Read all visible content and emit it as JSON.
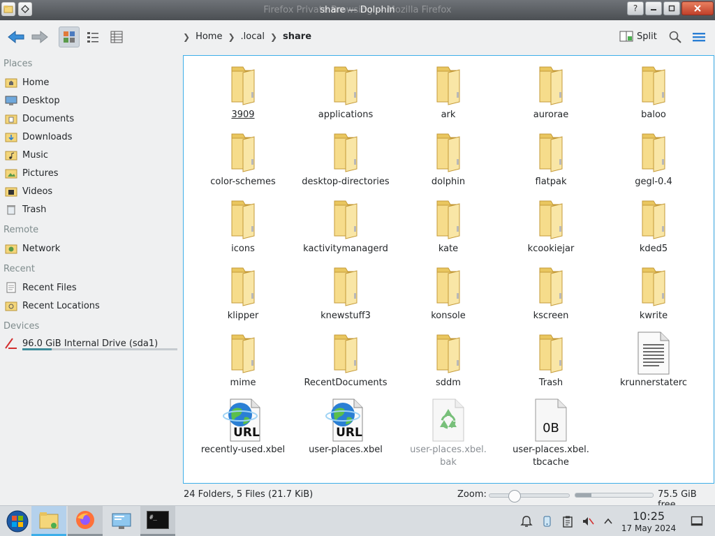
{
  "window": {
    "title": "share — Dolphin",
    "ghost_title": "Firefox Private Browsing — Mozilla Firefox",
    "help_btn": "?"
  },
  "toolbar": {
    "back_icon": "arrow-left-icon",
    "forward_icon": "arrow-right-icon",
    "view_modes": [
      "icons-view",
      "compact-view",
      "details-view"
    ],
    "breadcrumbs": [
      "Home",
      ".local",
      "share"
    ],
    "split_label": "Split",
    "search_icon": "search-icon",
    "menu_icon": "hamburger-menu-icon"
  },
  "sidebar": {
    "places_title": "Places",
    "places": [
      "Home",
      "Desktop",
      "Documents",
      "Downloads",
      "Music",
      "Pictures",
      "Videos",
      "Trash"
    ],
    "remote_title": "Remote",
    "remote": [
      "Network"
    ],
    "recent_title": "Recent",
    "recent": [
      "Recent Files",
      "Recent Locations"
    ],
    "devices_title": "Devices",
    "devices": [
      "96.0 GiB Internal Drive (sda1)"
    ],
    "drive_usage_fraction": 0.19
  },
  "files": {
    "items": [
      {
        "name": "3909",
        "type": "folder"
      },
      {
        "name": "applications",
        "type": "folder"
      },
      {
        "name": "ark",
        "type": "folder"
      },
      {
        "name": "aurorae",
        "type": "folder"
      },
      {
        "name": "baloo",
        "type": "folder"
      },
      {
        "name": "color-schemes",
        "type": "folder"
      },
      {
        "name": "desktop-directories",
        "type": "folder"
      },
      {
        "name": "dolphin",
        "type": "folder"
      },
      {
        "name": "flatpak",
        "type": "folder"
      },
      {
        "name": "gegl-0.4",
        "type": "folder"
      },
      {
        "name": "icons",
        "type": "folder"
      },
      {
        "name": "kactivitymanagerd",
        "type": "folder"
      },
      {
        "name": "kate",
        "type": "folder"
      },
      {
        "name": "kcookiejar",
        "type": "folder"
      },
      {
        "name": "kded5",
        "type": "folder"
      },
      {
        "name": "klipper",
        "type": "folder"
      },
      {
        "name": "knewstuff3",
        "type": "folder"
      },
      {
        "name": "konsole",
        "type": "folder"
      },
      {
        "name": "kscreen",
        "type": "folder"
      },
      {
        "name": "kwrite",
        "type": "folder"
      },
      {
        "name": "mime",
        "type": "folder"
      },
      {
        "name": "RecentDocuments",
        "type": "folder"
      },
      {
        "name": "sddm",
        "type": "folder"
      },
      {
        "name": "Trash",
        "type": "folder"
      },
      {
        "name": "krunnerstaterc",
        "type": "text"
      },
      {
        "name": "recently-used.xbel",
        "type": "url",
        "badge": "URL"
      },
      {
        "name": "user-places.xbel",
        "type": "url",
        "badge": "URL"
      },
      {
        "name": "user-places.xbel.\nbak",
        "type": "recycle",
        "dim": true
      },
      {
        "name": "user-places.xbel.\ntbcache",
        "type": "empty",
        "badge": "0B"
      }
    ]
  },
  "status": {
    "summary": "24 Folders, 5 Files (21.7 KiB)",
    "zoom_label": "Zoom:",
    "zoom_fraction": 0.28,
    "free_space": "75.5 GiB free",
    "disk_used_fraction": 0.21
  },
  "taskbar": {
    "apps": [
      "start-menu",
      "dolphin",
      "firefox",
      "system-settings",
      "konsole"
    ],
    "terminal_label": "#_",
    "time": "10:25",
    "date": "17 May 2024"
  },
  "colors": {
    "accent": "#3daee9",
    "folder": "#f4d67a"
  }
}
